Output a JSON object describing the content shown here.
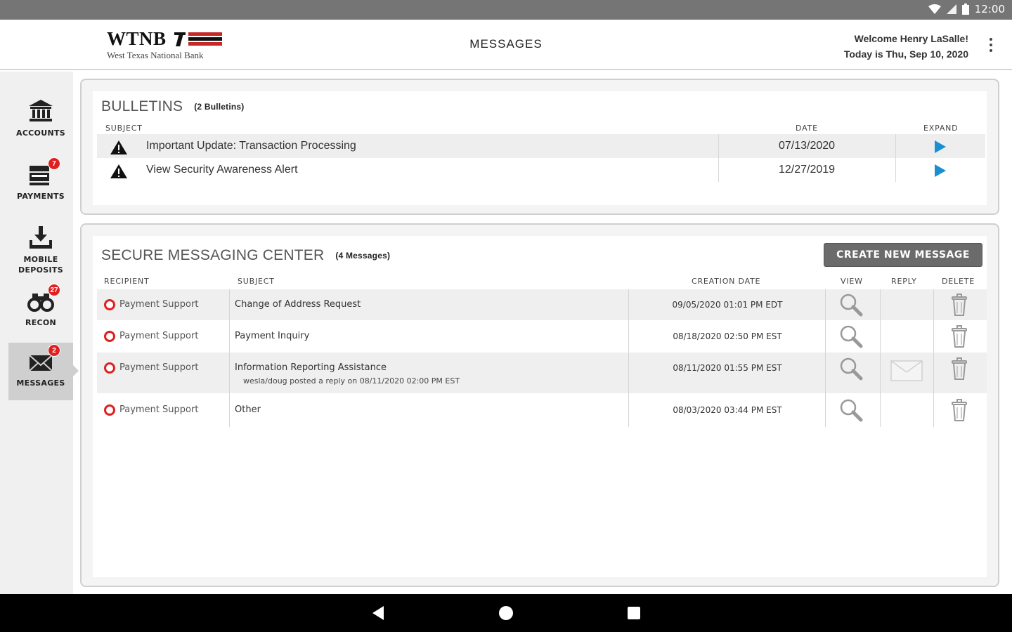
{
  "status_bar": {
    "time": "12:00"
  },
  "header": {
    "logo_text": "WTNB",
    "logo_subtitle": "West Texas National Bank",
    "title": "MESSAGES",
    "welcome": "Welcome Henry LaSalle!",
    "today": "Today is Thu, Sep 10, 2020"
  },
  "sidebar": {
    "items": [
      {
        "label": "ACCOUNTS",
        "icon": "bank-icon",
        "badge": ""
      },
      {
        "label": "PAYMENTS",
        "icon": "payments-icon",
        "badge": "7"
      },
      {
        "label_line1": "MOBILE",
        "label_line2": "DEPOSITS",
        "icon": "mobile-deposit-icon",
        "badge": ""
      },
      {
        "label": "RECON",
        "icon": "binoculars-icon",
        "badge": "27"
      },
      {
        "label": "MESSAGES",
        "icon": "envelope-icon",
        "badge": "2",
        "active": true
      }
    ]
  },
  "bulletins": {
    "title": "BULLETINS",
    "count": "(2 Bulletins)",
    "columns": {
      "subject": "SUBJECT",
      "date": "DATE",
      "expand": "EXPAND"
    },
    "rows": [
      {
        "subject": "Important Update: Transaction Processing",
        "date": "07/13/2020"
      },
      {
        "subject": "View Security Awareness Alert",
        "date": "12/27/2019"
      }
    ]
  },
  "messaging": {
    "title": "SECURE MESSAGING CENTER",
    "count": "(4 Messages)",
    "create_button": "CREATE NEW MESSAGE",
    "columns": {
      "recipient": "RECIPIENT",
      "subject": "SUBJECT",
      "creation_date": "CREATION DATE",
      "view": "VIEW",
      "reply": "REPLY",
      "delete": "DELETE"
    },
    "rows": [
      {
        "recipient": "Payment Support",
        "subject": "Change of Address Request",
        "note": "",
        "date": "09/05/2020 01:01 PM EDT",
        "has_reply": false
      },
      {
        "recipient": "Payment Support",
        "subject": "Payment Inquiry",
        "note": "",
        "date": "08/18/2020 02:50 PM EST",
        "has_reply": false
      },
      {
        "recipient": "Payment Support",
        "subject": "Information Reporting Assistance",
        "note": "wesla/doug posted a reply on 08/11/2020 02:00 PM EST",
        "date": "08/11/2020 01:55 PM EST",
        "has_reply": true
      },
      {
        "recipient": "Payment Support",
        "subject": "Other",
        "note": "",
        "date": "08/03/2020 03:44 PM EST",
        "has_reply": false
      }
    ]
  },
  "colors": {
    "accent_red": "#e02020",
    "expand_blue": "#1a8fd1",
    "button_gray": "#6b6b6b"
  }
}
